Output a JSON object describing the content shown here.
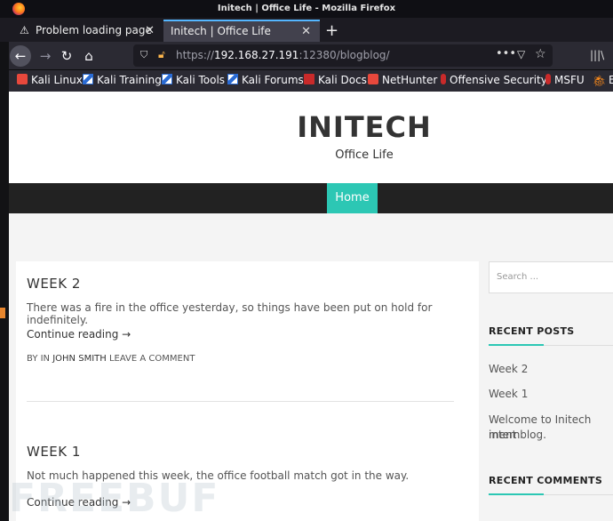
{
  "window": {
    "title": "Initech | Office Life - Mozilla Firefox"
  },
  "tabs": [
    {
      "label": "Problem loading page"
    },
    {
      "label": "Initech | Office Life"
    }
  ],
  "nav": {
    "url_scheme": "https://",
    "url_host": "192.168.27.191",
    "url_rest": ":12380/blogblog/"
  },
  "bookmarks": [
    {
      "label": "Kali Linux",
      "icon": "kali-icon"
    },
    {
      "label": "Kali Training",
      "icon": "kali-training-icon"
    },
    {
      "label": "Kali Tools",
      "icon": "kali-tools-icon"
    },
    {
      "label": "Kali Forums",
      "icon": "kali-forums-icon"
    },
    {
      "label": "Kali Docs",
      "icon": "kali-docs-icon"
    },
    {
      "label": "NetHunter",
      "icon": "nethunter-icon"
    },
    {
      "label": "Offensive Security",
      "icon": "offsec-icon"
    },
    {
      "label": "MSFU",
      "icon": "msfu-icon"
    },
    {
      "label": "E",
      "icon": "exploit-icon"
    }
  ],
  "site": {
    "title": "INITECH",
    "description": "Office Life",
    "menu_home": "Home"
  },
  "posts": [
    {
      "title": "WEEK 2",
      "excerpt": "There was a fire in the office yesterday, so things have been put on hold for indefinitely.",
      "more": "Continue reading →",
      "meta_prefix": "BY IN",
      "author": "JOHN SMITH",
      "comment": "LEAVE A COMMENT"
    },
    {
      "title": "WEEK 1",
      "excerpt": "Not much happened this week, the office football match got in the way.",
      "more": "Continue reading →"
    }
  ],
  "sidebar": {
    "search_placeholder": "Search ...",
    "recent_posts_title": "RECENT POSTS",
    "recent_posts": [
      "Week 2",
      "Week 1",
      "Welcome to Initech intern",
      "ment blog."
    ],
    "recent_comments_title": "RECENT COMMENTS"
  },
  "watermark": "FREEBUF",
  "colors": {
    "accent": "#2cc7b4",
    "menu_bg": "#222222",
    "firefox_chrome": "#2b2a33"
  }
}
